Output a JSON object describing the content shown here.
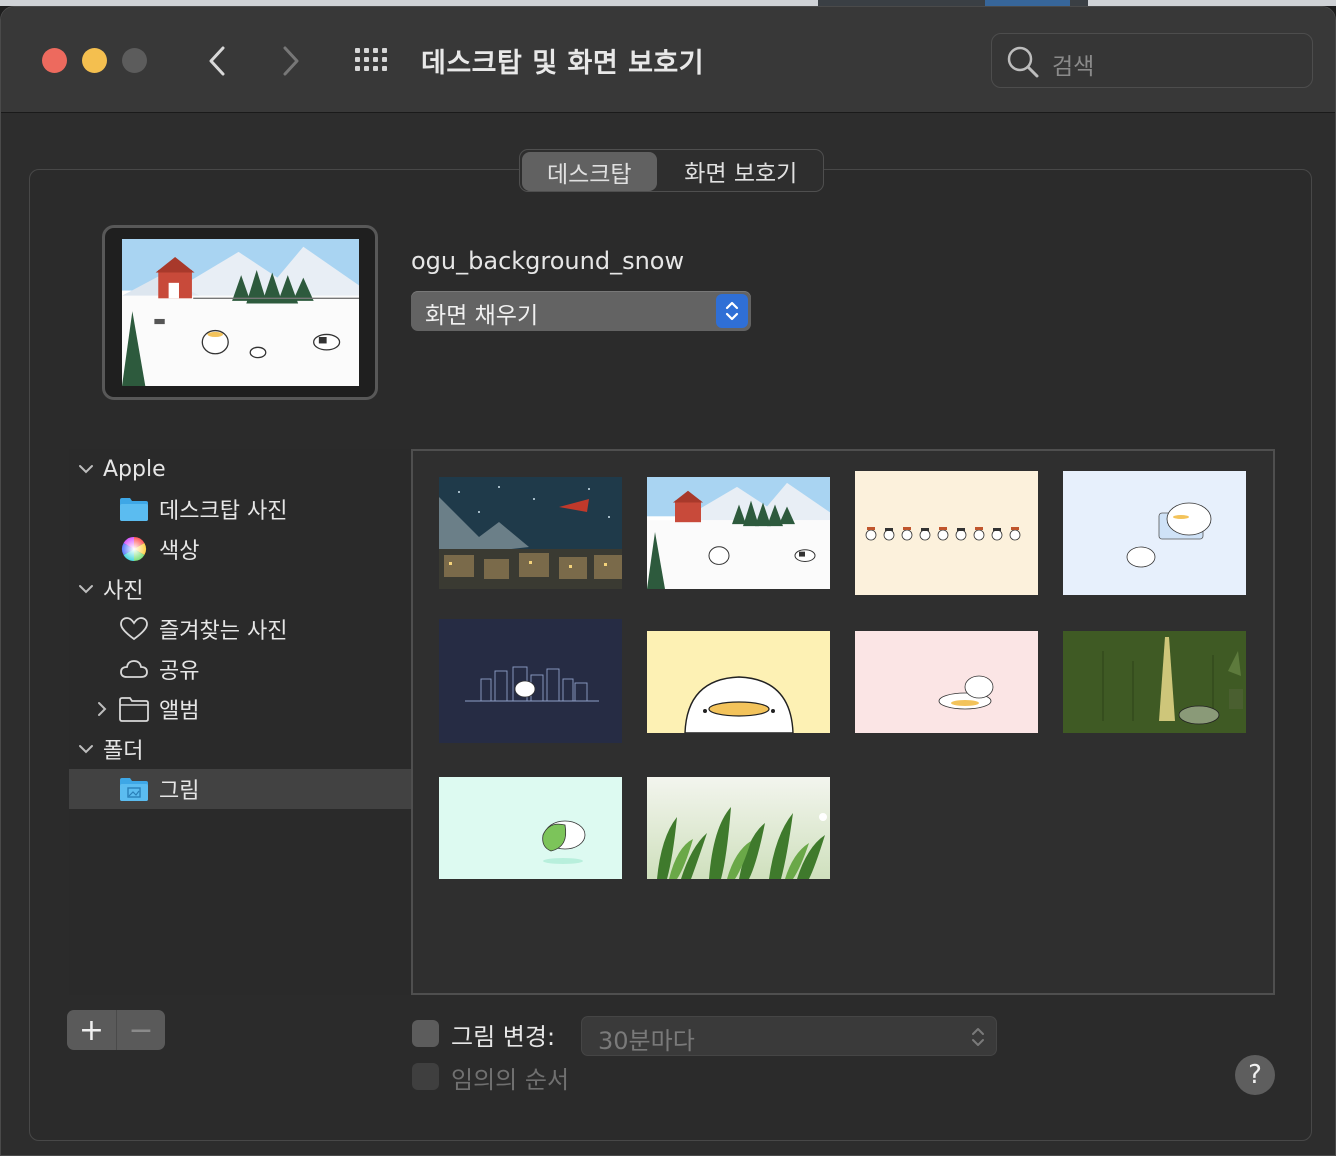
{
  "window": {
    "title": "데스크탑 및 화면 보호기",
    "search_placeholder": "검색"
  },
  "tabs": [
    {
      "label": "데스크탑",
      "selected": true
    },
    {
      "label": "화면 보호기",
      "selected": false
    }
  ],
  "current": {
    "name": "ogu_background_snow",
    "fill_mode": "화면 채우기"
  },
  "sidebar": {
    "groups": [
      {
        "label": "Apple",
        "expanded": true,
        "items": [
          {
            "label": "데스크탑 사진",
            "icon": "folder-icon"
          },
          {
            "label": "색상",
            "icon": "color-wheel-icon"
          }
        ]
      },
      {
        "label": "사진",
        "expanded": true,
        "items": [
          {
            "label": "즐겨찾는 사진",
            "icon": "heart-icon"
          },
          {
            "label": "공유",
            "icon": "cloud-icon"
          },
          {
            "label": "앨범",
            "icon": "folder-outline-icon",
            "collapsible": true
          }
        ]
      },
      {
        "label": "폴더",
        "expanded": true,
        "items": [
          {
            "label": "그림",
            "icon": "pictures-folder-icon",
            "selected": true
          }
        ]
      }
    ]
  },
  "wallpapers": [
    {
      "name": "night-sky-village",
      "selected": false
    },
    {
      "name": "snow-farm",
      "selected": true
    },
    {
      "name": "ducks-row-cream",
      "selected": false
    },
    {
      "name": "blue-sleepy-duck",
      "selected": false
    },
    {
      "name": "navy-city-night",
      "selected": false
    },
    {
      "name": "yellow-duck-closeup",
      "selected": false
    },
    {
      "name": "pink-resting-duck",
      "selected": false
    },
    {
      "name": "green-forest-duck",
      "selected": false
    },
    {
      "name": "mint-dino-duck",
      "selected": false
    },
    {
      "name": "green-leaves",
      "selected": false
    }
  ],
  "footer": {
    "add_label": "+",
    "remove_label": "−",
    "change_picture_label": "그림 변경:",
    "change_picture_checked": false,
    "interval": "30분마다",
    "random_order_label": "임의의 순서",
    "random_order_checked": false,
    "help_label": "?"
  },
  "colors": {
    "accent": "#2f6fd6",
    "close": "#ed6a5e",
    "minimize": "#f4bf4f"
  }
}
